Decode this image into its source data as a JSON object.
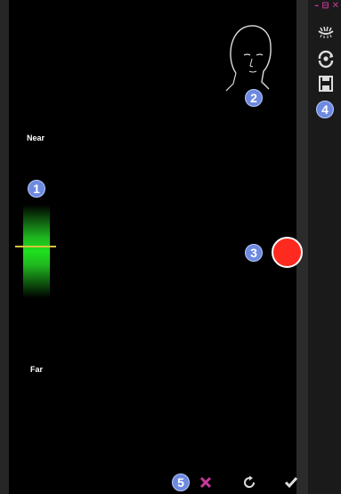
{
  "window_controls": {
    "minimize": "–",
    "restore": "⊟",
    "close": "✕"
  },
  "labels": {
    "near": "Near",
    "far": "Far"
  },
  "badges": {
    "b1": "1",
    "b2": "2",
    "b3": "3",
    "b4": "4",
    "b5": "5"
  },
  "toolbar": {
    "icons": [
      "eye-lashes-icon",
      "rotate-camera-icon",
      "save-icon"
    ]
  },
  "bottom_bar": {
    "icons": [
      "cancel-icon",
      "reset-icon",
      "confirm-icon"
    ]
  },
  "colors": {
    "accent": "#c8399a",
    "record": "#ff2a1f",
    "badge": "#6d8ae0",
    "depth": "#1ee01e",
    "depth_marker": "#d7c53a"
  }
}
